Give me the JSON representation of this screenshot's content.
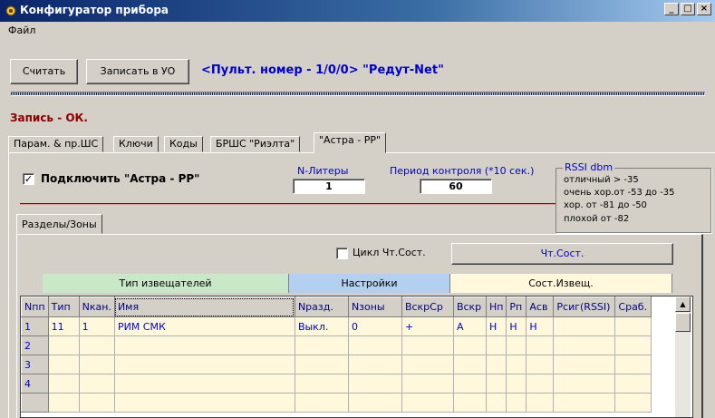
{
  "window": {
    "title": "Конфигуратор прибора",
    "min": "_",
    "max": "□",
    "close": "×"
  },
  "menu": {
    "file": "Файл"
  },
  "toolbar": {
    "read": "Считать",
    "write": "Записать в УО",
    "device": "<Пульт. номер - 1/0/0> \"Редут-Net\""
  },
  "status": "Запись - ОК.",
  "tabs": [
    "Парам. & пр.ШС",
    "Ключи",
    "Коды",
    "БРШС \"Риэлта\"",
    "\"Астра - РР\""
  ],
  "astra": {
    "connect_label": "Подключить  \"Астра - РР\"",
    "connect_checked": "✓",
    "nliter_label": "N-Литеры",
    "nliter_value": "1",
    "period_label": "Период контроля (*10 сек.)",
    "period_value": "60"
  },
  "rssi": {
    "title": "RSSI  dbm",
    "lines": [
      "отличный > -35",
      "очень хор.от -53 до -35",
      "хор. от -81 до -50",
      "плохой от -82"
    ]
  },
  "subtab": "Разделы/Зоны",
  "cycle_label": "Цикл Чт.Сост.",
  "read_state_button": "Чт.Сост.",
  "groups": {
    "types": "Тип извещателей",
    "settings": "Настройки",
    "state": "Сост.Извещ."
  },
  "colors": {
    "group_types": "#c8e8c8",
    "group_settings": "#b4d0f0",
    "group_state": "#fff8dc"
  },
  "table": {
    "headers": [
      "Nпп",
      "Тип",
      "Nкан.",
      "Имя",
      "Nразд.",
      "Nзоны",
      "ВскрСр",
      "Вскр",
      "Нп",
      "Рп",
      "Асв",
      "Рсиг(RSSI)",
      "Сраб."
    ],
    "rows": [
      [
        "1",
        "11",
        "1",
        "РИМ СМК",
        "Выкл.",
        "0",
        "+",
        "А",
        "Н",
        "Н",
        "Н",
        "",
        ""
      ],
      [
        "2",
        "",
        "",
        "",
        "",
        "",
        "",
        "",
        "",
        "",
        "",
        "",
        ""
      ],
      [
        "3",
        "",
        "",
        "",
        "",
        "",
        "",
        "",
        "",
        "",
        "",
        "",
        ""
      ],
      [
        "4",
        "",
        "",
        "",
        "",
        "",
        "",
        "",
        "",
        "",
        "",
        "",
        ""
      ],
      [
        "",
        "",
        "",
        "",
        "",
        "",
        "",
        "",
        "",
        "",
        "",
        "",
        ""
      ]
    ]
  },
  "icons": {
    "app": "gear-icon",
    "scroll_up": "arrow-up-icon",
    "scroll_down": "arrow-down-icon"
  }
}
